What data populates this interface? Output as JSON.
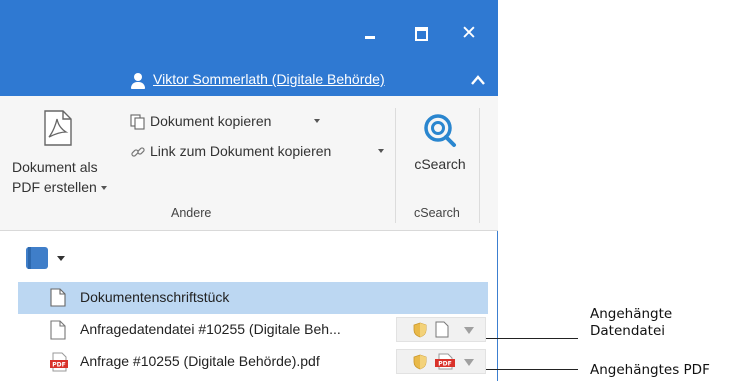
{
  "window": {
    "minimize_icon": "minimize-icon",
    "maximize_icon": "maximize-icon",
    "close_glyph": "✕"
  },
  "user": {
    "name": "Viktor Sommerlath (Digitale Behörde)",
    "icon": "user-icon",
    "collapse_icon": "chevron-up-icon"
  },
  "ribbon": {
    "pdf_button_label": "Dokument als\nPDF erstellen",
    "copy_doc_label": "Dokument kopieren",
    "copy_link_label": "Link zum Dokument kopieren",
    "group_andere": "Andere",
    "csearch_label": "cSearch",
    "group_csearch": "cSearch"
  },
  "tree": {
    "rows": [
      {
        "label": "Dokumentenschriftstück",
        "icon": "document-icon",
        "selected": true
      },
      {
        "label": "Anfragedatendatei #10255 (Digitale Beh...",
        "icon": "file-icon"
      },
      {
        "label": "Anfrage #10255 (Digitale Behörde).pdf",
        "icon": "pdf-icon"
      }
    ]
  },
  "callouts": {
    "data_file": "Angehängte\nDatendatei",
    "pdf": "Angehängtes PDF"
  },
  "colors": {
    "titlebar": "#2f79d2",
    "selection": "#bcd7f2",
    "pdf_red": "#d9322a",
    "shield": "#e9b949"
  }
}
